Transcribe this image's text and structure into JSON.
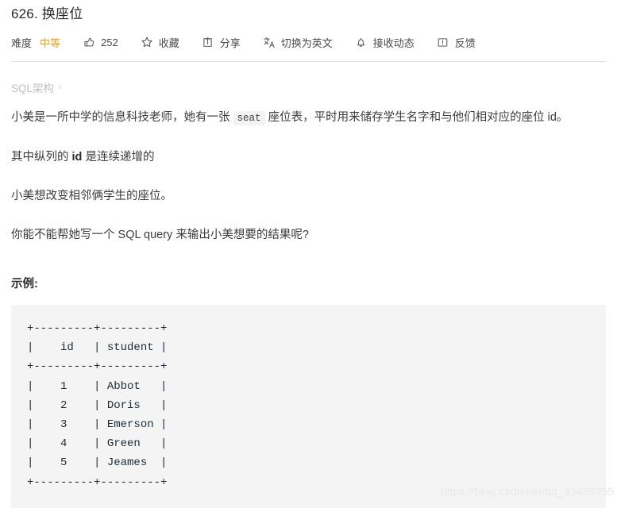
{
  "problem": {
    "title": "626. 换座位"
  },
  "toolbar": {
    "difficulty_label": "难度",
    "difficulty_value": "中等",
    "difficulty_color": "#f0a020",
    "like_icon": "thumbs-up-icon",
    "like_count": "252",
    "favorite_icon": "star-icon",
    "favorite_label": "收藏",
    "share_icon": "share-icon",
    "share_label": "分享",
    "translate_icon": "translate-icon",
    "translate_label": "切换为英文",
    "subscribe_icon": "bell-icon",
    "subscribe_label": "接收动态",
    "feedback_icon": "feedback-icon",
    "feedback_label": "反馈"
  },
  "schema": {
    "label": "SQL架构",
    "chevron": "›"
  },
  "description": {
    "paragraph1_before": "小美是一所中学的信息科技老师，她有一张 ",
    "paragraph1_code": "seat",
    "paragraph1_after": " 座位表，平时用来储存学生名字和与他们相对应的座位 id。",
    "paragraph2_before": "其中纵列的 ",
    "paragraph2_keyword": "id",
    "paragraph2_after": " 是连续递增的",
    "paragraph3": "小美想改变相邻俩学生的座位。",
    "paragraph4": "你能不能帮她写一个 SQL query 来输出小美想要的结果呢?"
  },
  "example": {
    "heading": "示例:",
    "table_ascii": "+---------+---------+\n|    id   | student |\n+---------+---------+\n|    1    | Abbot   |\n|    2    | Doris   |\n|    3    | Emerson |\n|    4    | Green   |\n|    5    | Jeames  |\n+---------+---------+",
    "columns": [
      "id",
      "student"
    ],
    "rows": [
      [
        "1",
        "Abbot"
      ],
      [
        "2",
        "Doris"
      ],
      [
        "3",
        "Emerson"
      ],
      [
        "4",
        "Green"
      ],
      [
        "5",
        "Jeames"
      ]
    ]
  },
  "watermark": {
    "text": "https://blog.csdn.net/qq_33489955"
  }
}
